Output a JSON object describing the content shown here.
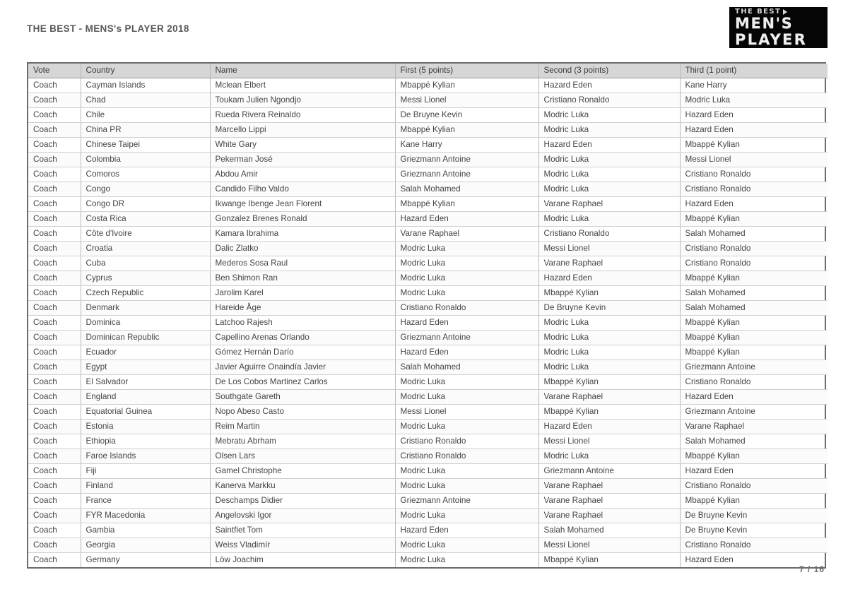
{
  "document": {
    "title": "THE BEST - MENS's PLAYER 2018",
    "page_number": "7 / 16"
  },
  "logo": {
    "line1": "THE BEST",
    "line2": "MEN'S",
    "line3": "PLAYER"
  },
  "table": {
    "columns": [
      "Vote",
      "Country",
      "Name",
      "First (5 points)",
      "Second (3 points)",
      "Third (1 point)"
    ],
    "rows": [
      [
        "Coach",
        "Cayman Islands",
        "Mclean Elbert",
        "Mbappé Kylian",
        "Hazard Eden",
        "Kane Harry"
      ],
      [
        "Coach",
        "Chad",
        "Toukam Julien  Ngondjo",
        "Messi Lionel",
        "Cristiano Ronaldo",
        "Modric Luka"
      ],
      [
        "Coach",
        "Chile",
        "Rueda Rivera Reinaldo",
        "De Bruyne Kevin",
        "Modric Luka",
        "Hazard Eden"
      ],
      [
        "Coach",
        "China PR",
        "Marcello Lippi",
        "Mbappé Kylian",
        "Modric Luka",
        "Hazard Eden"
      ],
      [
        "Coach",
        "Chinese Taipei",
        "White Gary",
        "Kane Harry",
        "Hazard Eden",
        "Mbappé Kylian"
      ],
      [
        "Coach",
        "Colombia",
        "Pekerman José",
        "Griezmann Antoine",
        "Modric Luka",
        "Messi Lionel"
      ],
      [
        "Coach",
        "Comoros",
        "Abdou Amir",
        "Griezmann Antoine",
        "Modric Luka",
        "Cristiano Ronaldo"
      ],
      [
        "Coach",
        "Congo",
        "Candido Filho Valdo",
        "Salah Mohamed",
        "Modric Luka",
        "Cristiano Ronaldo"
      ],
      [
        "Coach",
        "Congo DR",
        "Ikwange Ibenge Jean Florent",
        "Mbappé Kylian",
        "Varane Raphael",
        "Hazard Eden"
      ],
      [
        "Coach",
        "Costa Rica",
        "Gonzalez Brenes Ronald",
        "Hazard Eden",
        "Modric Luka",
        "Mbappé Kylian"
      ],
      [
        "Coach",
        "Côte d'Ivoire",
        "Kamara Ibrahima",
        "Varane Raphael",
        "Cristiano Ronaldo",
        "Salah Mohamed"
      ],
      [
        "Coach",
        "Croatia",
        "Dalic Zlatko",
        "Modric Luka",
        "Messi Lionel",
        "Cristiano Ronaldo"
      ],
      [
        "Coach",
        "Cuba",
        "Mederos Sosa Raul",
        "Modric Luka",
        "Varane Raphael",
        "Cristiano Ronaldo"
      ],
      [
        "Coach",
        "Cyprus",
        "Ben Shimon Ran",
        "Modric Luka",
        "Hazard Eden",
        "Mbappé Kylian"
      ],
      [
        "Coach",
        "Czech Republic",
        "Jarolim Karel",
        "Modric Luka",
        "Mbappé Kylian",
        "Salah Mohamed"
      ],
      [
        "Coach",
        "Denmark",
        "Hareide Åge",
        "Cristiano Ronaldo",
        "De Bruyne Kevin",
        "Salah Mohamed"
      ],
      [
        "Coach",
        "Dominica",
        "Latchoo Rajesh",
        "Hazard Eden",
        "Modric Luka",
        "Mbappé Kylian"
      ],
      [
        "Coach",
        "Dominican Republic",
        "Capellino Arenas Orlando",
        "Griezmann Antoine",
        "Modric Luka",
        "Mbappé Kylian"
      ],
      [
        "Coach",
        "Ecuador",
        "Gómez Hernán Darío",
        "Hazard Eden",
        "Modric Luka",
        "Mbappé Kylian"
      ],
      [
        "Coach",
        "Egypt",
        "Javier Aguirre Onaindía Javier",
        "Salah Mohamed",
        "Modric Luka",
        "Griezmann Antoine"
      ],
      [
        "Coach",
        "El Salvador",
        "De Los Cobos Martinez Carlos",
        "Modric Luka",
        "Mbappé Kylian",
        "Cristiano Ronaldo"
      ],
      [
        "Coach",
        "England",
        "Southgate Gareth",
        "Modric Luka",
        "Varane Raphael",
        "Hazard Eden"
      ],
      [
        "Coach",
        "Equatorial Guinea",
        "Nopo Abeso Casto",
        "Messi Lionel",
        "Mbappé Kylian",
        "Griezmann Antoine"
      ],
      [
        "Coach",
        "Estonia",
        "Reim Martin",
        "Modric Luka",
        "Hazard Eden",
        "Varane Raphael"
      ],
      [
        "Coach",
        "Ethiopia",
        "Mebratu Abrham",
        "Cristiano Ronaldo",
        "Messi Lionel",
        "Salah Mohamed"
      ],
      [
        "Coach",
        "Faroe Islands",
        "Olsen Lars",
        "Cristiano Ronaldo",
        "Modric Luka",
        "Mbappé Kylian"
      ],
      [
        "Coach",
        "Fiji",
        "Gamel Christophe",
        "Modric Luka",
        "Griezmann Antoine",
        "Hazard Eden"
      ],
      [
        "Coach",
        "Finland",
        "Kanerva Markku",
        "Modric Luka",
        "Varane Raphael",
        "Cristiano Ronaldo"
      ],
      [
        "Coach",
        "France",
        "Deschamps  Didier",
        "Griezmann Antoine",
        "Varane Raphael",
        "Mbappé Kylian"
      ],
      [
        "Coach",
        "FYR Macedonia",
        "Angelovski Igor",
        "Modric Luka",
        "Varane Raphael",
        "De Bruyne Kevin"
      ],
      [
        "Coach",
        "Gambia",
        "Saintfiet Tom",
        "Hazard Eden",
        "Salah Mohamed",
        "De Bruyne Kevin"
      ],
      [
        "Coach",
        "Georgia",
        "Weiss Vladimír",
        "Modric Luka",
        "Messi Lionel",
        "Cristiano Ronaldo"
      ],
      [
        "Coach",
        "Germany",
        "Löw Joachim",
        "Modric Luka",
        "Mbappé Kylian",
        "Hazard Eden"
      ]
    ]
  }
}
